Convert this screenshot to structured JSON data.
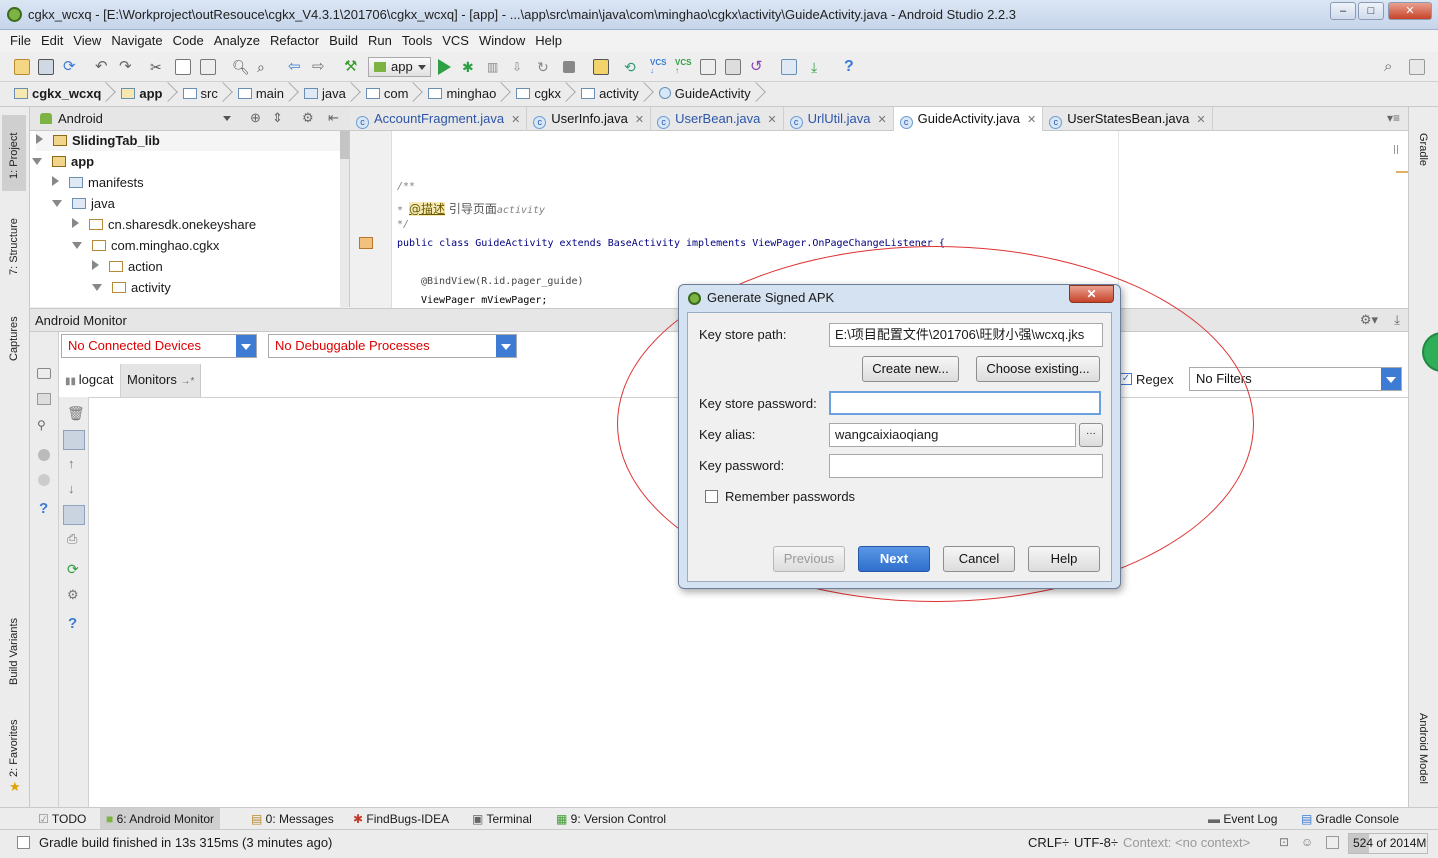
{
  "window": {
    "title": "cgkx_wcxq - [E:\\Workproject\\outResouce\\cgkx_V4.3.1\\201706\\cgkx_wcxq] - [app] - ...\\app\\src\\main\\java\\com\\minghao\\cgkx\\activity\\GuideActivity.java - Android Studio 2.2.3"
  },
  "menu": [
    "File",
    "Edit",
    "View",
    "Navigate",
    "Code",
    "Analyze",
    "Refactor",
    "Build",
    "Run",
    "Tools",
    "VCS",
    "Window",
    "Help"
  ],
  "toolbar": {
    "run_config": "app"
  },
  "breadcrumb": [
    "cgkx_wcxq",
    "app",
    "src",
    "main",
    "java",
    "com",
    "minghao",
    "cgkx",
    "activity",
    "GuideActivity"
  ],
  "project": {
    "view_mode": "Android",
    "tree": [
      {
        "label": "SlidingTab_lib",
        "bold": true
      },
      {
        "label": "app",
        "bold": true
      },
      {
        "label": "manifests"
      },
      {
        "label": "java"
      },
      {
        "label": "cn.sharesdk.onekeyshare"
      },
      {
        "label": "com.minghao.cgkx"
      },
      {
        "label": "action"
      },
      {
        "label": "activity"
      }
    ]
  },
  "editor_tabs": [
    "AccountFragment.java",
    "UserInfo.java",
    "UserBean.java",
    "UrlUtil.java",
    "GuideActivity.java",
    "UserStatesBean.java"
  ],
  "code": {
    "l1": "/**",
    "l2a": " * ",
    "l2b": "@描述",
    "l2c": " 引导页面",
    "l2d": "activity",
    "l3": " */",
    "l4": "public class GuideActivity extends BaseActivity implements ViewPager.OnPageChangeListener {",
    "l5": "@BindView(R.id.pager_guide)",
    "l6": "ViewPager mViewPager;"
  },
  "side_left": [
    "1: Project",
    "7: Structure",
    "Captures",
    "Build Variants",
    "2: Favorites"
  ],
  "side_right": [
    "Gradle",
    "Android Model"
  ],
  "monitor": {
    "title": "Android Monitor",
    "devices": "No Connected Devices",
    "processes": "No Debuggable Processes",
    "tab_logcat": "logcat",
    "tab_monitors": "Monitors",
    "regex_label": "Regex",
    "filter": "No Filters"
  },
  "dialog": {
    "title": "Generate Signed APK",
    "key_store_path_label": "Key store path:",
    "key_store_path": "E:\\项目配置文件\\201706\\旺财小强\\wcxq.jks",
    "create_new": "Create new...",
    "choose_existing": "Choose existing...",
    "key_store_password_label": "Key store password:",
    "key_alias_label": "Key alias:",
    "key_alias": "wangcaixiaoqiang",
    "key_password_label": "Key password:",
    "remember": "Remember passwords",
    "previous": "Previous",
    "next": "Next",
    "cancel": "Cancel",
    "help": "Help"
  },
  "bottom_tabs": [
    "TODO",
    "6: Android Monitor",
    "0: Messages",
    "FindBugs-IDEA",
    "Terminal",
    "9: Version Control",
    "Event Log",
    "Gradle Console"
  ],
  "status": {
    "message": "Gradle build finished in 13s 315ms (3 minutes ago)",
    "line_sep": "CRLF÷",
    "encoding": "UTF-8÷",
    "context": "Context: <no context>",
    "memory": "524 of 2014M",
    "memory_fraction": 0.26
  },
  "colors": {
    "accent": "#3d7bd4",
    "error_text": "#d00000",
    "annotation": "#e03232"
  }
}
